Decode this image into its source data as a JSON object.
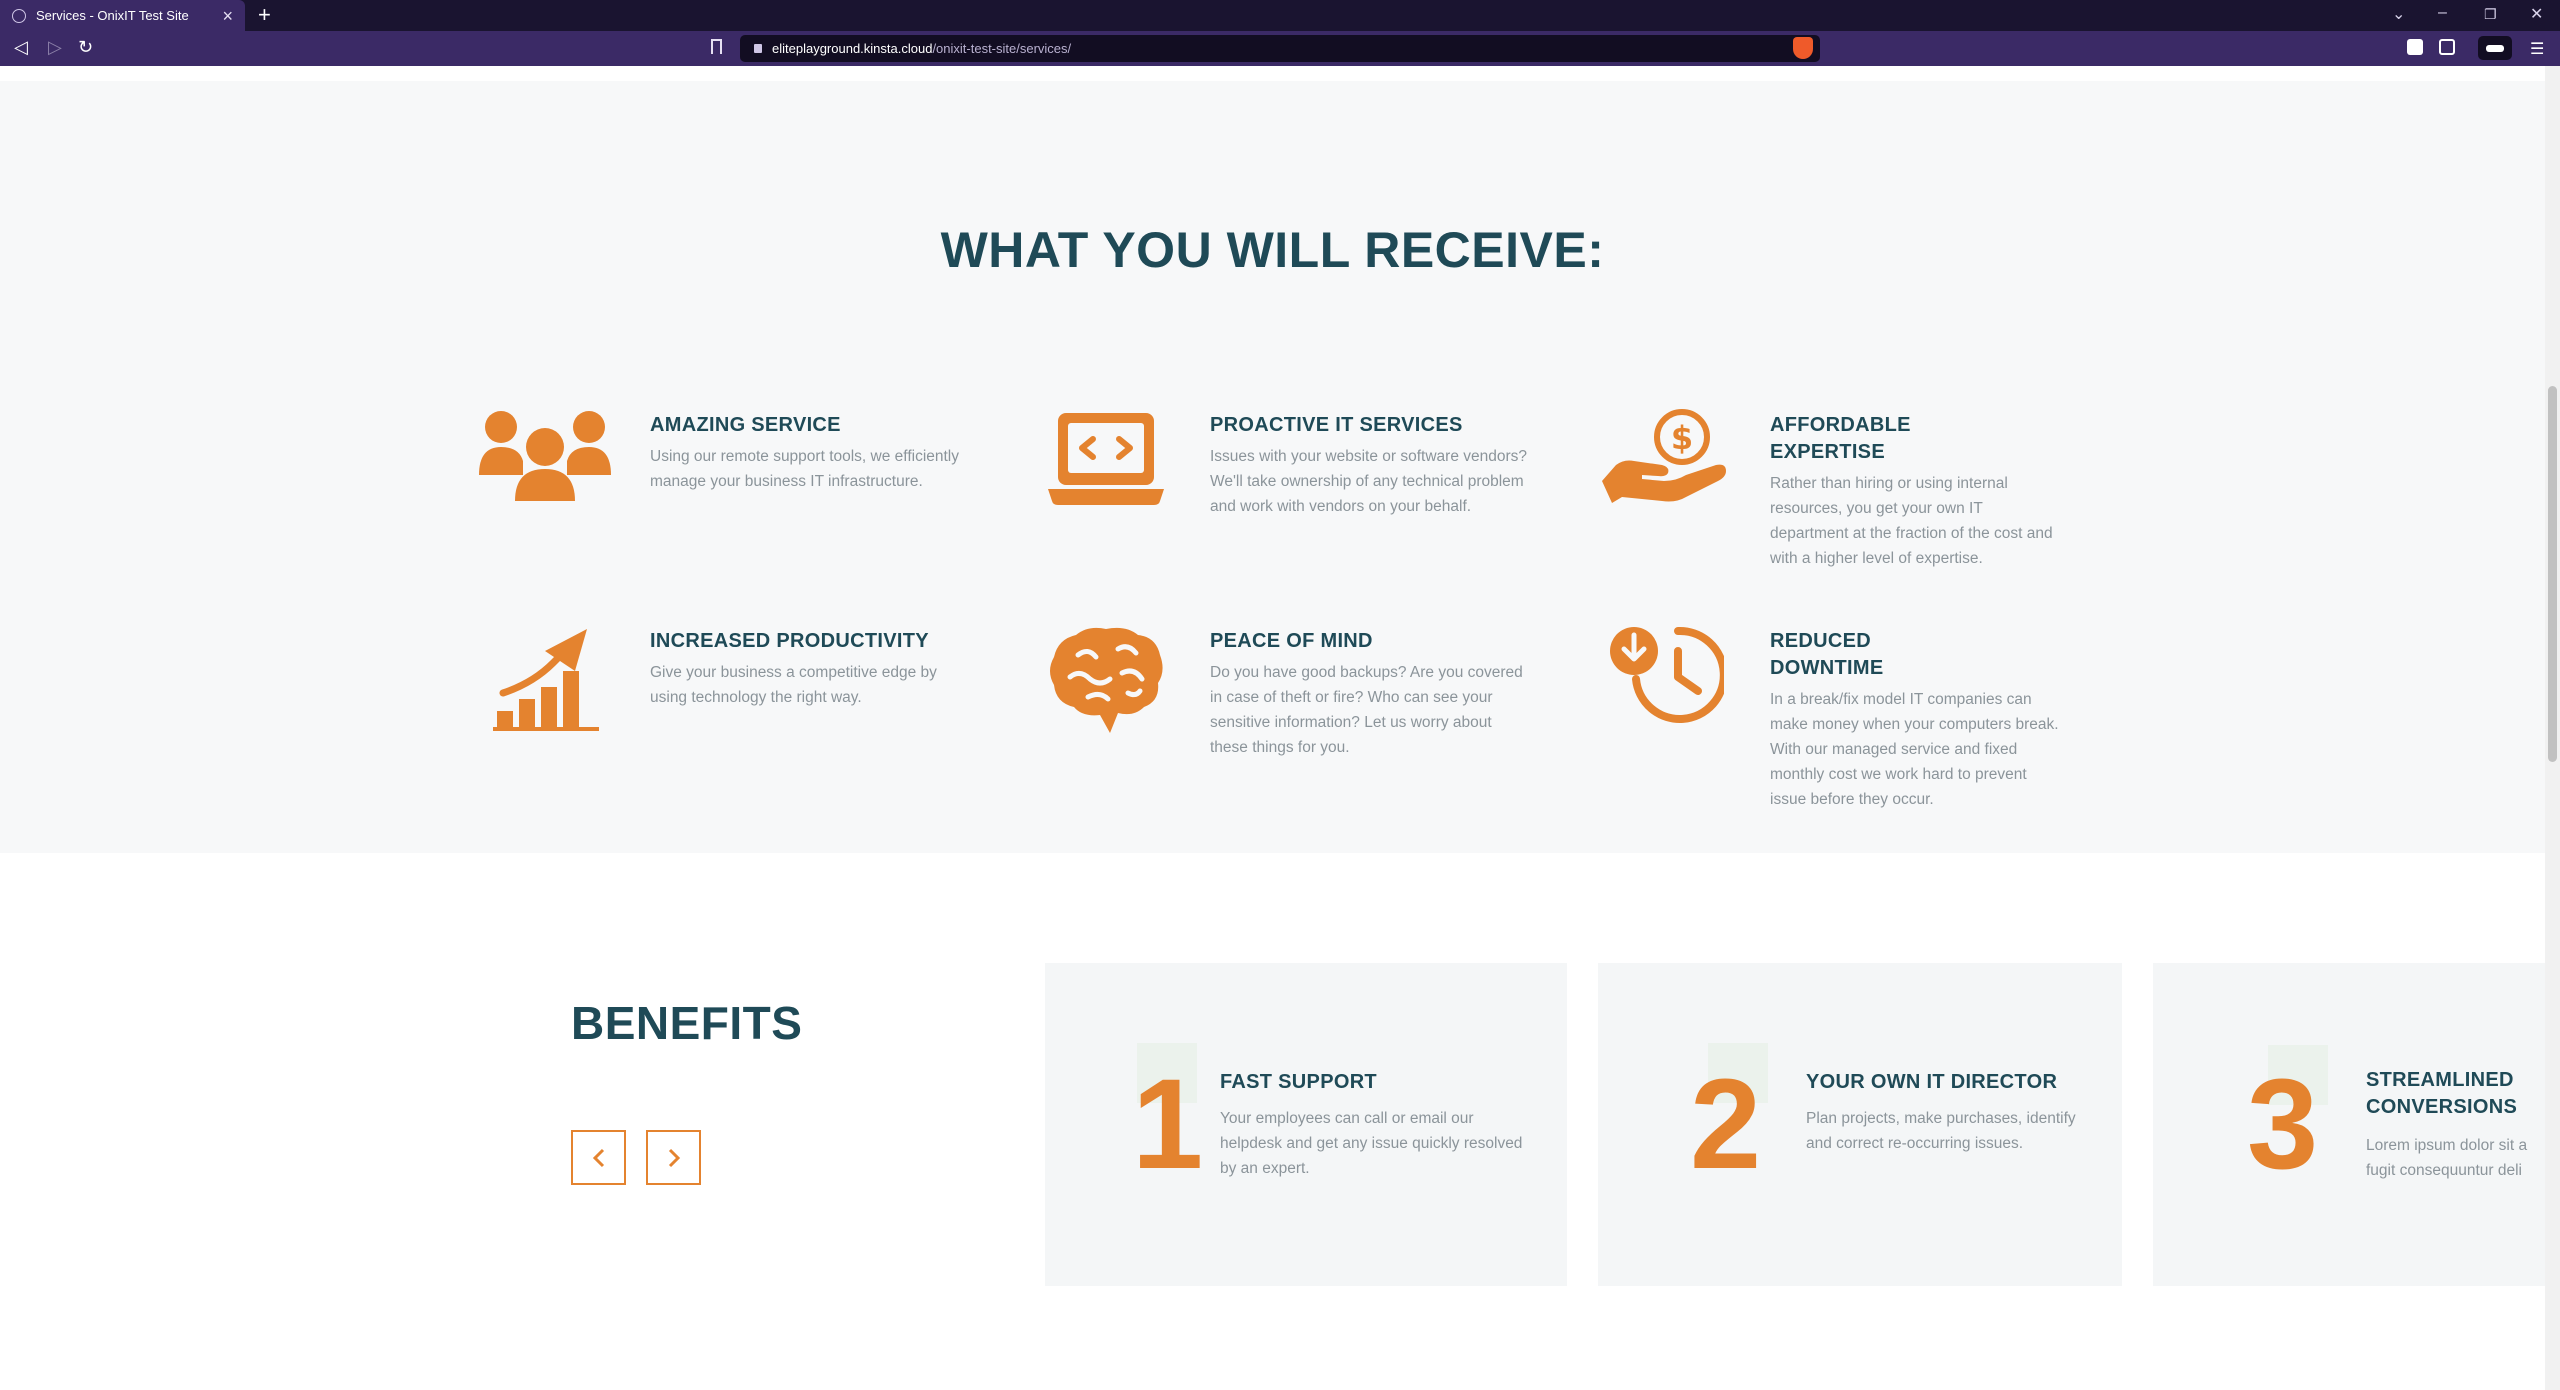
{
  "browser": {
    "tab_title": "Services - OnixIT Test Site",
    "new_tab": "+",
    "url_host": "eliteplayground.kinsta.cloud",
    "url_path": "/onixit-test-site/services/"
  },
  "receive": {
    "heading": "WHAT YOU WILL RECEIVE:",
    "features": [
      {
        "title": "AMAZING SERVICE",
        "text": "Using our remote support tools, we efficiently manage your business IT infrastructure.",
        "icon": "people-icon"
      },
      {
        "title": "PROACTIVE IT SERVICES",
        "text": "Issues with your website or software vendors? We'll take ownership of any technical problem and work with vendors on your behalf.",
        "icon": "laptop-code-icon"
      },
      {
        "title": "AFFORDABLE EXPERTISE",
        "text": "Rather than hiring or using internal resources, you get your own IT department at the fraction of the cost and with a higher level of expertise.",
        "icon": "hand-dollar-icon"
      },
      {
        "title": "INCREASED PRODUCTIVITY",
        "text": "Give your business a competitive edge by using technology the right way.",
        "icon": "growth-chart-icon"
      },
      {
        "title": "PEACE OF MIND",
        "text": "Do you have good backups? Are you covered in case of theft or fire? Who can see your sensitive information? Let us worry about these things for you.",
        "icon": "brain-icon"
      },
      {
        "title": "REDUCED DOWNTIME",
        "text": "In a break/fix model IT companies can make money when your computers break. With our managed service and fixed monthly cost we work hard to prevent issue before they occur.",
        "icon": "clock-download-icon"
      }
    ]
  },
  "benefits": {
    "title": "BENEFITS",
    "cards": [
      {
        "number": "1",
        "title": "FAST SUPPORT",
        "text": "Your employees can call or email our helpdesk and get any issue quickly resolved by an expert."
      },
      {
        "number": "2",
        "title": "YOUR OWN IT DIRECTOR",
        "text": "Plan projects, make purchases, identify and correct re-occurring issues."
      },
      {
        "number": "3",
        "title": "STREAMLINED CONVERSIONS",
        "text": "Lorem ipsum dolor sit a fugit consequuntur deli"
      }
    ]
  },
  "colors": {
    "accent": "#e4832f",
    "heading": "#1f4a57",
    "body_text": "#8b949a",
    "section_bg": "#f7f8f9",
    "browser_bar": "#3b2a66"
  }
}
